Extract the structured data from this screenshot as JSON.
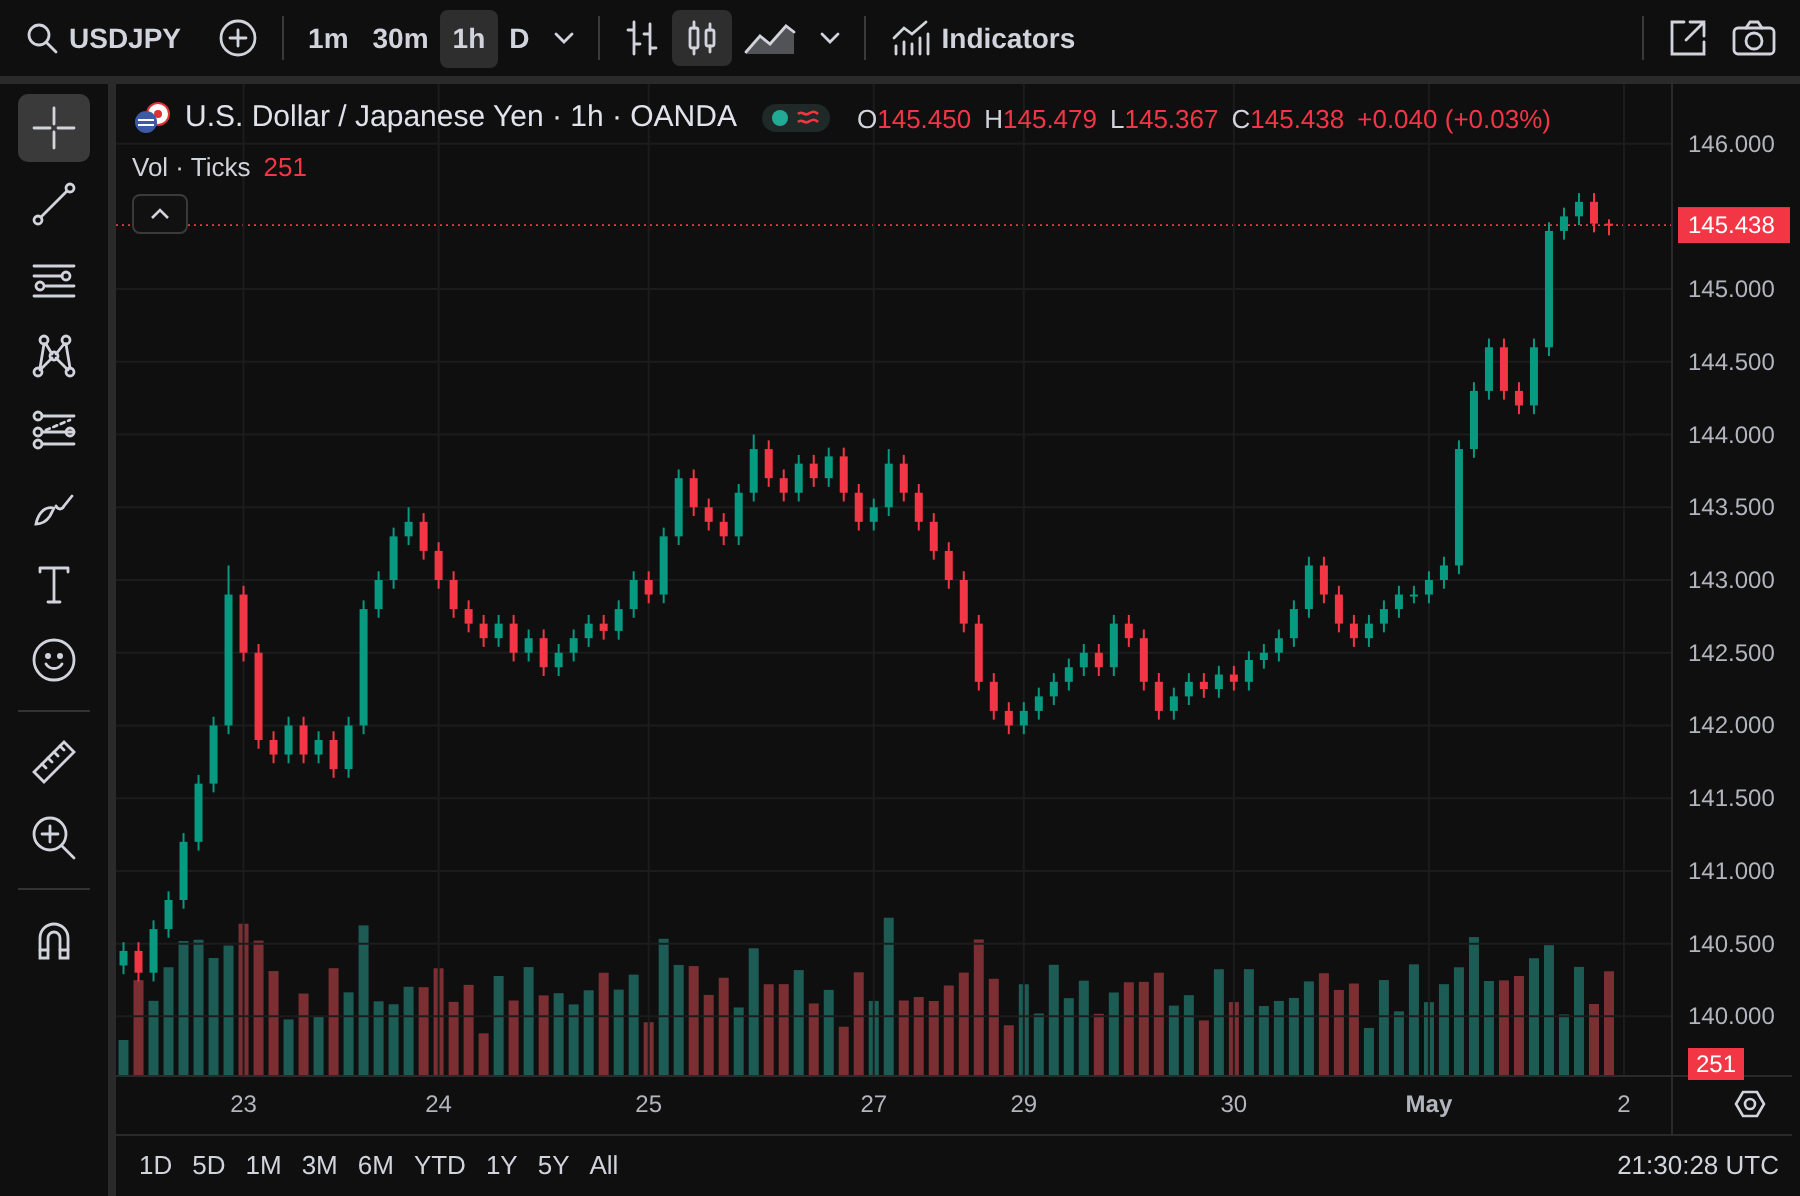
{
  "toolbar": {
    "symbol": "USDJPY",
    "intervals": [
      {
        "label": "1m",
        "selected": false
      },
      {
        "label": "30m",
        "selected": false
      },
      {
        "label": "1h",
        "selected": true
      },
      {
        "label": "D",
        "selected": false
      }
    ],
    "chart_styles": [
      {
        "kind": "bars",
        "selected": false
      },
      {
        "kind": "candles",
        "selected": true
      },
      {
        "kind": "area",
        "selected": false
      }
    ],
    "indicators_label": "Indicators"
  },
  "drawing_tools": [
    {
      "kind": "crosshair",
      "selected": true
    },
    {
      "kind": "trend-line",
      "selected": false
    },
    {
      "kind": "channel",
      "selected": false
    },
    {
      "kind": "pattern",
      "selected": false
    },
    {
      "kind": "fib",
      "selected": false
    },
    {
      "kind": "brush",
      "selected": false
    },
    {
      "kind": "text",
      "selected": false
    },
    {
      "kind": "emoji",
      "selected": false
    },
    {
      "kind": "divider"
    },
    {
      "kind": "ruler",
      "selected": false
    },
    {
      "kind": "zoom",
      "selected": false
    },
    {
      "kind": "divider"
    },
    {
      "kind": "magnet",
      "selected": false
    }
  ],
  "legend": {
    "title": "U.S. Dollar / Japanese Yen · 1h · OANDA",
    "ohlc": [
      {
        "label": "O",
        "value": "145.450"
      },
      {
        "label": "H",
        "value": "145.479"
      },
      {
        "label": "L",
        "value": "145.367"
      },
      {
        "label": "C",
        "value": "145.438"
      }
    ],
    "change": "+0.040 (+0.03%)",
    "volume_label": "Vol · Ticks",
    "volume_value": "251"
  },
  "price_chart": {
    "chart_data": {
      "type": "candlestick",
      "grid": true,
      "categories": [
        null,
        null,
        null,
        null,
        null,
        null,
        null,
        null,
        "23",
        null,
        null,
        null,
        null,
        null,
        null,
        null,
        null,
        null,
        null,
        null,
        null,
        "24",
        null,
        null,
        null,
        null,
        null,
        null,
        null,
        null,
        null,
        null,
        null,
        null,
        null,
        "25",
        null,
        null,
        null,
        null,
        null,
        null,
        null,
        null,
        null,
        null,
        null,
        null,
        null,
        null,
        "27",
        null,
        null,
        null,
        null,
        null,
        null,
        null,
        null,
        null,
        "29",
        null,
        null,
        null,
        null,
        null,
        null,
        null,
        null,
        null,
        null,
        null,
        null,
        null,
        "30",
        null,
        null,
        null,
        null,
        null,
        null,
        null,
        null,
        null,
        null,
        null,
        null,
        "May",
        null,
        null,
        null,
        null,
        null,
        null,
        null,
        null,
        null,
        null,
        null,
        null,
        "2"
      ],
      "ylim": [
        139.59,
        146.41
      ],
      "yticks": [
        {
          "value": 146,
          "label": "146.000"
        },
        {
          "value": 145,
          "label": "145.000"
        },
        {
          "value": 144.5,
          "label": "144.500"
        },
        {
          "value": 144,
          "label": "144.000"
        },
        {
          "value": 143.5,
          "label": "143.500"
        },
        {
          "value": 143,
          "label": "143.000"
        },
        {
          "value": 142.5,
          "label": "142.500"
        },
        {
          "value": 142,
          "label": "142.000"
        },
        {
          "value": 141.5,
          "label": "141.500"
        },
        {
          "value": 141,
          "label": "141.000"
        },
        {
          "value": 140.5,
          "label": "140.500"
        },
        {
          "value": 140,
          "label": "140.000"
        }
      ],
      "ohlc": [
        [
          140.35,
          140.51,
          140.29,
          140.45
        ],
        [
          140.45,
          140.51,
          140.24,
          140.3
        ],
        [
          140.3,
          140.66,
          140.24,
          140.6
        ],
        [
          140.6,
          140.86,
          140.54,
          140.8
        ],
        [
          140.8,
          141.26,
          140.74,
          141.2
        ],
        [
          141.2,
          141.66,
          141.14,
          141.6
        ],
        [
          141.6,
          142.06,
          141.54,
          142.0
        ],
        [
          142.0,
          143.1,
          141.94,
          142.9
        ],
        [
          142.9,
          142.96,
          142.44,
          142.5
        ],
        [
          142.5,
          142.56,
          141.84,
          141.9
        ],
        [
          141.9,
          141.96,
          141.74,
          141.8
        ],
        [
          141.8,
          142.06,
          141.74,
          142.0
        ],
        [
          142.0,
          142.06,
          141.74,
          141.8
        ],
        [
          141.8,
          141.96,
          141.74,
          141.9
        ],
        [
          141.9,
          141.96,
          141.64,
          141.7
        ],
        [
          141.7,
          142.06,
          141.64,
          142.0
        ],
        [
          142.0,
          142.86,
          141.94,
          142.8
        ],
        [
          142.8,
          143.06,
          142.74,
          143.0
        ],
        [
          143.0,
          143.36,
          142.94,
          143.3
        ],
        [
          143.3,
          143.5,
          143.24,
          143.4
        ],
        [
          143.4,
          143.46,
          143.14,
          143.2
        ],
        [
          143.2,
          143.26,
          142.94,
          143.0
        ],
        [
          143.0,
          143.06,
          142.74,
          142.8
        ],
        [
          142.8,
          142.86,
          142.64,
          142.7
        ],
        [
          142.7,
          142.76,
          142.54,
          142.6
        ],
        [
          142.6,
          142.76,
          142.54,
          142.7
        ],
        [
          142.7,
          142.76,
          142.44,
          142.5
        ],
        [
          142.5,
          142.66,
          142.44,
          142.6
        ],
        [
          142.6,
          142.66,
          142.34,
          142.4
        ],
        [
          142.4,
          142.56,
          142.34,
          142.5
        ],
        [
          142.5,
          142.66,
          142.44,
          142.6
        ],
        [
          142.6,
          142.76,
          142.54,
          142.7
        ],
        [
          142.7,
          142.76,
          142.59,
          142.65
        ],
        [
          142.65,
          142.86,
          142.59,
          142.8
        ],
        [
          142.8,
          143.06,
          142.74,
          143.0
        ],
        [
          143.0,
          143.06,
          142.84,
          142.9
        ],
        [
          142.9,
          143.36,
          142.84,
          143.3
        ],
        [
          143.3,
          143.76,
          143.24,
          143.7
        ],
        [
          143.7,
          143.76,
          143.44,
          143.5
        ],
        [
          143.5,
          143.56,
          143.34,
          143.4
        ],
        [
          143.4,
          143.46,
          143.24,
          143.3
        ],
        [
          143.3,
          143.66,
          143.24,
          143.6
        ],
        [
          143.6,
          144.0,
          143.54,
          143.9
        ],
        [
          143.9,
          143.96,
          143.64,
          143.7
        ],
        [
          143.7,
          143.76,
          143.54,
          143.6
        ],
        [
          143.6,
          143.86,
          143.54,
          143.8
        ],
        [
          143.8,
          143.86,
          143.64,
          143.7
        ],
        [
          143.7,
          143.91,
          143.64,
          143.85
        ],
        [
          143.85,
          143.91,
          143.54,
          143.6
        ],
        [
          143.6,
          143.66,
          143.34,
          143.4
        ],
        [
          143.4,
          143.56,
          143.34,
          143.5
        ],
        [
          143.5,
          143.9,
          143.44,
          143.8
        ],
        [
          143.8,
          143.86,
          143.54,
          143.6
        ],
        [
          143.6,
          143.66,
          143.34,
          143.4
        ],
        [
          143.4,
          143.46,
          143.14,
          143.2
        ],
        [
          143.2,
          143.26,
          142.94,
          143.0
        ],
        [
          143.0,
          143.06,
          142.64,
          142.7
        ],
        [
          142.7,
          142.76,
          142.24,
          142.3
        ],
        [
          142.3,
          142.36,
          142.04,
          142.1
        ],
        [
          142.1,
          142.16,
          141.94,
          142.0
        ],
        [
          142.0,
          142.16,
          141.94,
          142.1
        ],
        [
          142.1,
          142.26,
          142.04,
          142.2
        ],
        [
          142.2,
          142.36,
          142.14,
          142.3
        ],
        [
          142.3,
          142.46,
          142.24,
          142.4
        ],
        [
          142.4,
          142.56,
          142.34,
          142.5
        ],
        [
          142.5,
          142.56,
          142.34,
          142.4
        ],
        [
          142.4,
          142.76,
          142.34,
          142.7
        ],
        [
          142.7,
          142.76,
          142.54,
          142.6
        ],
        [
          142.6,
          142.66,
          142.24,
          142.3
        ],
        [
          142.3,
          142.36,
          142.04,
          142.1
        ],
        [
          142.1,
          142.26,
          142.04,
          142.2
        ],
        [
          142.2,
          142.36,
          142.14,
          142.3
        ],
        [
          142.3,
          142.36,
          142.19,
          142.25
        ],
        [
          142.25,
          142.41,
          142.19,
          142.35
        ],
        [
          142.35,
          142.41,
          142.24,
          142.3
        ],
        [
          142.3,
          142.51,
          142.24,
          142.45
        ],
        [
          142.45,
          142.56,
          142.39,
          142.5
        ],
        [
          142.5,
          142.66,
          142.44,
          142.6
        ],
        [
          142.6,
          142.86,
          142.54,
          142.8
        ],
        [
          142.8,
          143.16,
          142.74,
          143.1
        ],
        [
          143.1,
          143.16,
          142.84,
          142.9
        ],
        [
          142.9,
          142.96,
          142.64,
          142.7
        ],
        [
          142.7,
          142.76,
          142.54,
          142.6
        ],
        [
          142.6,
          142.76,
          142.54,
          142.7
        ],
        [
          142.7,
          142.86,
          142.64,
          142.8
        ],
        [
          142.8,
          142.96,
          142.74,
          142.9
        ],
        [
          142.9,
          142.96,
          142.84,
          142.9
        ],
        [
          142.9,
          143.06,
          142.84,
          143.0
        ],
        [
          143.0,
          143.16,
          142.94,
          143.1
        ],
        [
          143.1,
          143.96,
          143.04,
          143.9
        ],
        [
          143.9,
          144.36,
          143.84,
          144.3
        ],
        [
          144.3,
          144.66,
          144.24,
          144.6
        ],
        [
          144.6,
          144.66,
          144.24,
          144.3
        ],
        [
          144.3,
          144.36,
          144.14,
          144.2
        ],
        [
          144.2,
          144.66,
          144.14,
          144.6
        ],
        [
          144.6,
          145.46,
          144.54,
          145.4
        ],
        [
          145.4,
          145.56,
          145.34,
          145.5
        ],
        [
          145.5,
          145.66,
          145.44,
          145.6
        ],
        [
          145.6,
          145.66,
          145.39,
          145.45
        ],
        [
          145.45,
          145.48,
          145.37,
          145.44
        ],
        null
      ]
    },
    "last_price": "145.438",
    "last_volume": "251"
  },
  "ranges": [
    "1D",
    "5D",
    "1M",
    "3M",
    "6M",
    "YTD",
    "1Y",
    "5Y",
    "All"
  ],
  "clock": "21:30:28 UTC"
}
